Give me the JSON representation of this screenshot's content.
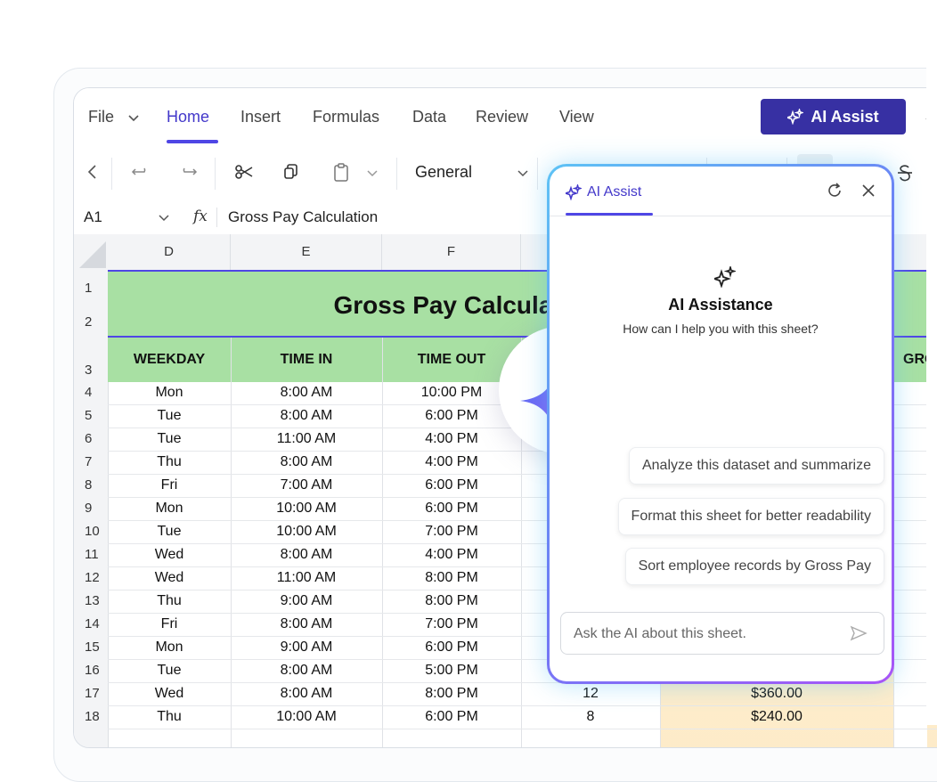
{
  "menubar": {
    "file": "File",
    "tabs": [
      "Home",
      "Insert",
      "Formulas",
      "Data",
      "Review",
      "View"
    ],
    "active_tab": "Home",
    "ai_assist_label": "AI Assist"
  },
  "toolbar": {
    "number_format": "General"
  },
  "formula_bar": {
    "cell_ref": "A1",
    "fx": "fx",
    "formula": "Gross Pay Calculation"
  },
  "columns": [
    "D",
    "E",
    "F"
  ],
  "row_numbers": [
    "1",
    "2",
    "3",
    "4",
    "5",
    "6",
    "7",
    "8",
    "9",
    "10",
    "11",
    "12",
    "13",
    "14",
    "15",
    "16",
    "17",
    "18"
  ],
  "sheet": {
    "title": "Gross Pay Calculati",
    "headers": [
      "WEEKDAY",
      "TIME IN",
      "TIME OUT",
      "GRO"
    ],
    "rows": [
      {
        "weekday": "Mon",
        "time_in": "8:00 AM",
        "time_out": "10:00 PM"
      },
      {
        "weekday": "Tue",
        "time_in": "8:00 AM",
        "time_out": "6:00 PM"
      },
      {
        "weekday": "Tue",
        "time_in": "11:00 AM",
        "time_out": "4:00 PM"
      },
      {
        "weekday": "Thu",
        "time_in": "8:00 AM",
        "time_out": "4:00 PM"
      },
      {
        "weekday": "Fri",
        "time_in": "7:00 AM",
        "time_out": "6:00 PM"
      },
      {
        "weekday": "Mon",
        "time_in": "10:00 AM",
        "time_out": "6:00 PM"
      },
      {
        "weekday": "Tue",
        "time_in": "10:00 AM",
        "time_out": "7:00 PM"
      },
      {
        "weekday": "Wed",
        "time_in": "8:00 AM",
        "time_out": "4:00 PM"
      },
      {
        "weekday": "Wed",
        "time_in": "11:00 AM",
        "time_out": "8:00 PM"
      },
      {
        "weekday": "Thu",
        "time_in": "9:00 AM",
        "time_out": "8:00 PM"
      },
      {
        "weekday": "Fri",
        "time_in": "8:00 AM",
        "time_out": "7:00 PM"
      },
      {
        "weekday": "Mon",
        "time_in": "9:00 AM",
        "time_out": "6:00 PM"
      },
      {
        "weekday": "Tue",
        "time_in": "8:00 AM",
        "time_out": "5:00 PM"
      },
      {
        "weekday": "Wed",
        "time_in": "8:00 AM",
        "time_out": "8:00 PM",
        "hours": "12",
        "gross_pay": "$360.00"
      },
      {
        "weekday": "Thu",
        "time_in": "10:00 AM",
        "time_out": "6:00 PM",
        "hours": "8",
        "gross_pay": "$240.00"
      }
    ]
  },
  "ai_panel": {
    "tab_label": "AI Assist",
    "title": "AI Assistance",
    "subtitle": "How can I help you with this sheet?",
    "suggestions": [
      "Analyze this dataset and summarize",
      "Format this sheet for better readability",
      "Sort employee records by Gross Pay"
    ],
    "input_placeholder": "Ask the AI about this sheet."
  },
  "colors": {
    "accent": "#4f46e5",
    "ai_button": "#3730a3",
    "header_green": "#a8e0a3",
    "gross_fill": "#fdebc8"
  }
}
